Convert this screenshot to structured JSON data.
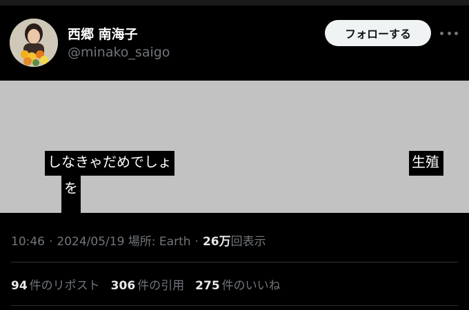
{
  "author": {
    "display_name": "西郷 南海子",
    "handle": "@minako_saigo"
  },
  "follow_button_label": "フォローする",
  "image_overlay": {
    "line1": "しなきゃだめでしょ",
    "line2": "生殖",
    "line3": "を"
  },
  "meta": {
    "time": "10:46",
    "date": "2024/05/19",
    "location": "場所: Earth",
    "views_count": "26万",
    "views_label": "回表示"
  },
  "stats": {
    "reposts_count": "94",
    "reposts_label": "件のリポスト",
    "quotes_count": "306",
    "quotes_label": "件の引用",
    "likes_count": "275",
    "likes_label": "件のいいね"
  },
  "colors": {
    "background": "#000000",
    "secondary_text": "#71767b",
    "follow_button_bg": "#eff3f4",
    "image_placeholder": "#c2c2c2"
  }
}
